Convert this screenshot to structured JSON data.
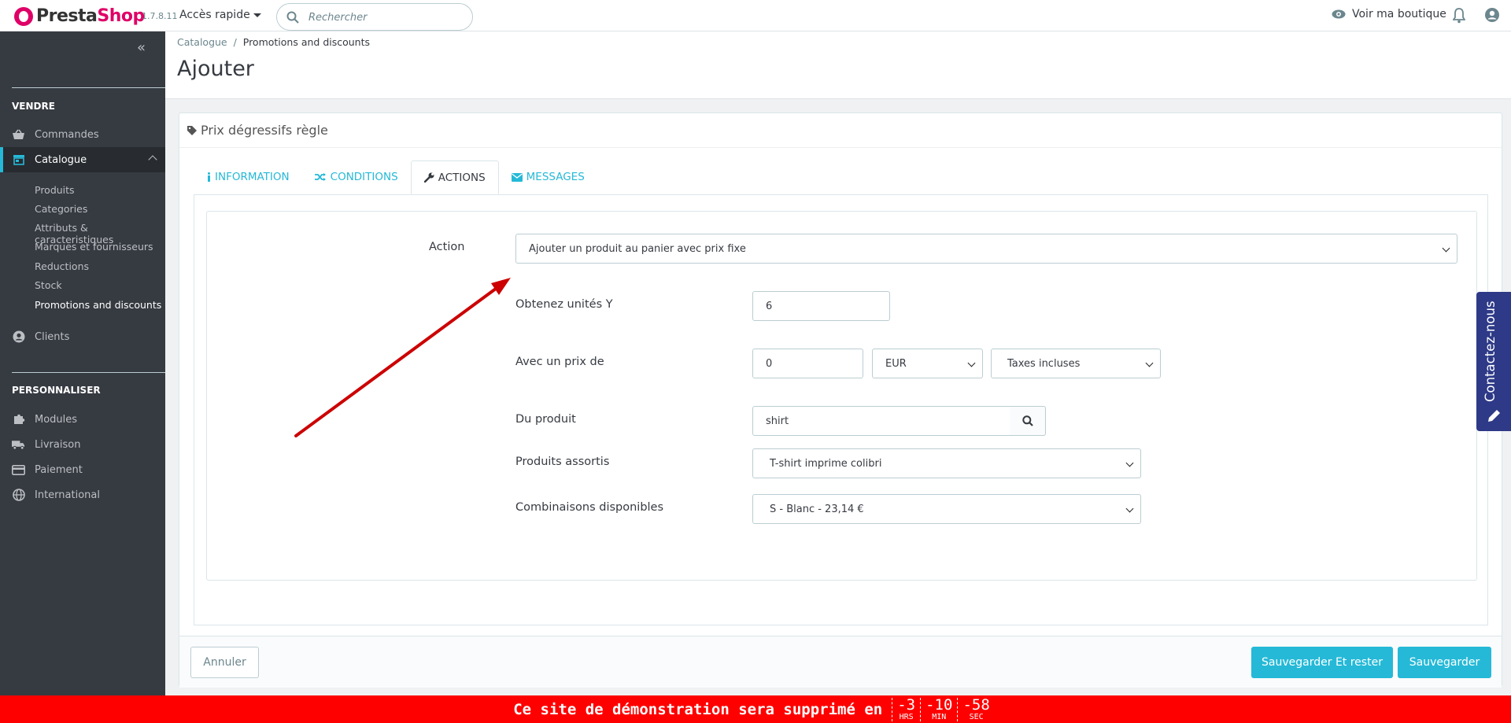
{
  "header": {
    "brand_part1": "Presta",
    "brand_part2": "Shop",
    "version": "1.7.8.11",
    "quick_access": "Accès rapide",
    "search_placeholder": "Rechercher",
    "view_shop": "Voir ma boutique"
  },
  "sidebar": {
    "section_sell": "VENDRE",
    "section_customize": "PERSONNALISER",
    "items": {
      "orders": "Commandes",
      "catalog": "Catalogue",
      "clients": "Clients",
      "modules": "Modules",
      "shipping": "Livraison",
      "payment": "Paiement",
      "international": "International"
    },
    "catalog_sub": [
      "Produits",
      "Categories",
      "Attributs & caracteristiques",
      "Marques et fournisseurs",
      "Reductions",
      "Stock",
      "Promotions and discounts"
    ]
  },
  "breadcrumb": {
    "parent": "Catalogue",
    "separator": "/",
    "current": "Promotions and discounts"
  },
  "page_title": "Ajouter",
  "panel": {
    "title": "Prix dégressifs règle",
    "tabs": [
      "INFORMATION",
      "CONDITIONS",
      "ACTIONS",
      "MESSAGES"
    ],
    "action_label": "Action",
    "action_value": "Ajouter un produit au panier avec prix fixe",
    "units_label": "Obtenez unités Y",
    "units_value": "6",
    "price_label": "Avec un prix de",
    "price_value": "0",
    "currency_value": "EUR",
    "tax_value": "Taxes incluses",
    "product_label": "Du produit",
    "product_value": "shirt",
    "matched_label": "Produits assortis",
    "matched_value": "T-shirt imprime colibri",
    "combos_label": "Combinaisons disponibles",
    "combos_value": "S - Blanc - 23,14 €",
    "cancel": "Annuler",
    "save_stay": "Sauvegarder Et rester",
    "save": "Sauvegarder"
  },
  "contact_tab": "Contactez-nous",
  "demo_bar": {
    "message": "Ce site de démonstration sera supprimé en",
    "hours": "-3",
    "hours_unit": "HRS",
    "minutes": "-10",
    "minutes_unit": "MIN",
    "seconds": "-58",
    "seconds_unit": "SEC"
  },
  "colors": {
    "accent": "#25b9d7",
    "brand": "#df0067",
    "sidebar": "#363a41",
    "demo_bar": "#ff0000",
    "arrow": "#cc0000"
  }
}
